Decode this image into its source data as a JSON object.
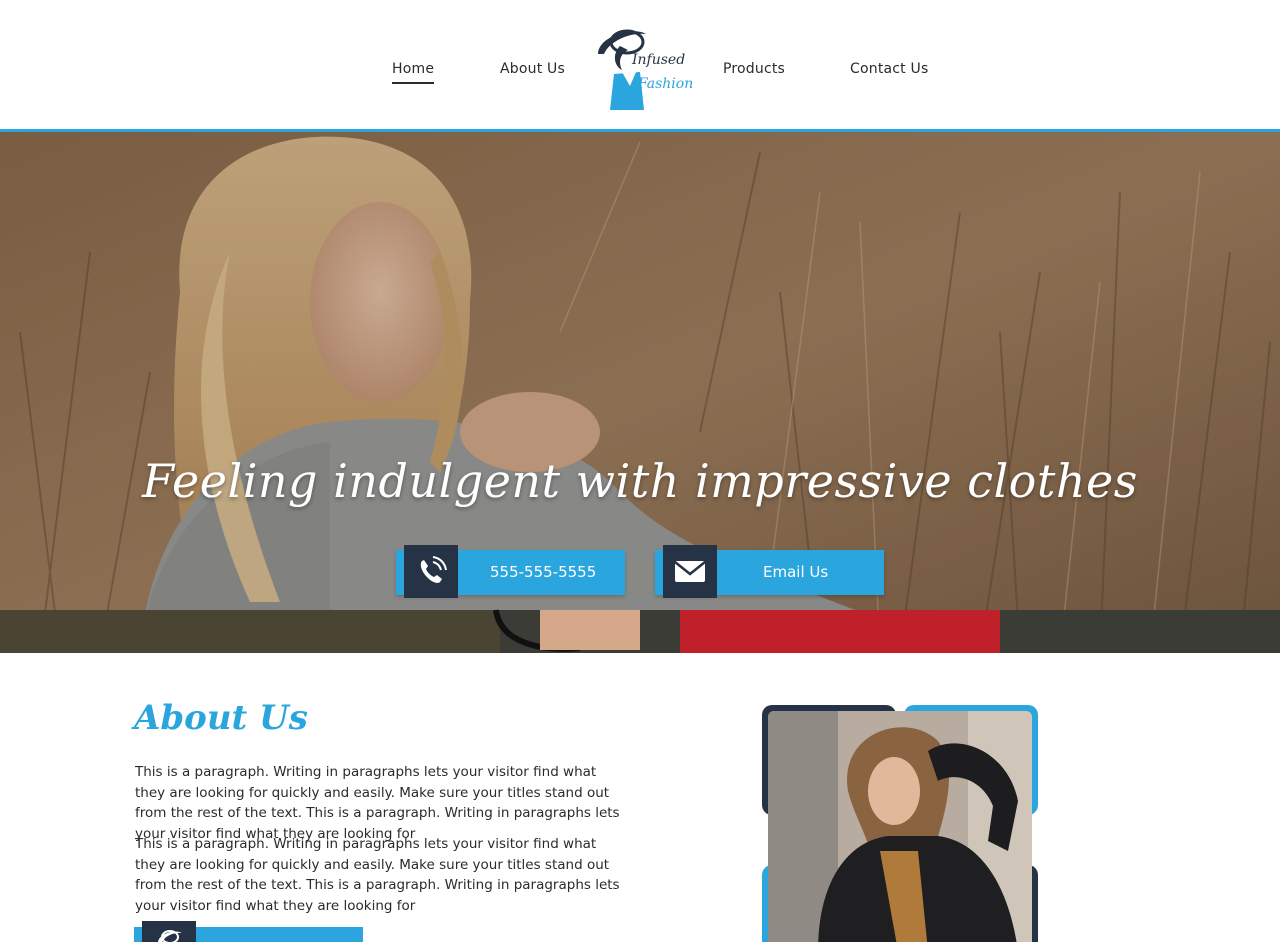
{
  "nav": {
    "items": [
      {
        "label": "Home",
        "active": true
      },
      {
        "label": "About Us",
        "active": false
      },
      {
        "label": "Products",
        "active": false
      },
      {
        "label": "Contact Us",
        "active": false
      }
    ],
    "logo": {
      "line1": "Infused",
      "line2": "Fashion"
    }
  },
  "hero": {
    "title": "Feeling indulgent with impressive clothes",
    "phone": {
      "label": "555-555-5555",
      "icon": "phone-icon"
    },
    "email": {
      "label": "Email Us",
      "icon": "envelope-icon"
    }
  },
  "about": {
    "title": "About Us",
    "paragraphs": [
      "This is a paragraph. Writing in paragraphs lets your visitor find what they are looking for quickly and easily. Make sure your titles stand out from the rest of the text. This is a paragraph. Writing in paragraphs lets your visitor find what they are looking for",
      "This is a paragraph. Writing in paragraphs lets your visitor find what they are looking for quickly and easily. Make sure your titles stand out from the rest of the text. This is a paragraph. Writing in paragraphs lets your visitor find what they are looking for"
    ]
  },
  "colors": {
    "accent": "#2aa5dd",
    "dark": "#263245"
  }
}
